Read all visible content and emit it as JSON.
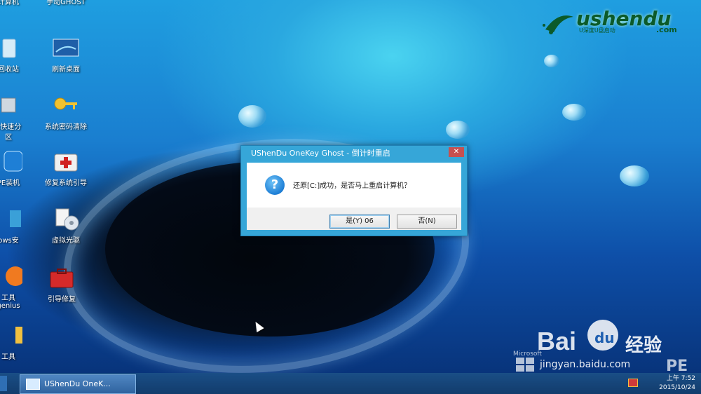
{
  "desktop": {
    "icons": [
      {
        "label": "计算机",
        "icon": "computer-icon"
      },
      {
        "label": "手动GHOST",
        "icon": "ghost-icon"
      },
      {
        "label": "回收站",
        "icon": "recycle-bin-icon"
      },
      {
        "label": "刷新桌面",
        "icon": "refresh-desktop-icon"
      },
      {
        "label": "K快速分\n区",
        "icon": "partition-icon"
      },
      {
        "label": "系统密码清除",
        "icon": "key-icon"
      },
      {
        "label": "PE装机",
        "icon": "pe-install-icon"
      },
      {
        "label": "修复系统引导",
        "icon": "medkit-icon"
      },
      {
        "label": "ows安",
        "icon": "windows-install-icon"
      },
      {
        "label": "虚拟光驱",
        "icon": "virtual-cd-icon"
      },
      {
        "label": "工具\ngenius",
        "icon": "disk-genius-icon"
      },
      {
        "label": "引导修复",
        "icon": "toolbox-icon"
      },
      {
        "label": "工具",
        "icon": "tool-icon"
      }
    ]
  },
  "logo": {
    "name": "ushendu",
    "sub": "U深度U盘启动",
    "dotcom": ".com"
  },
  "dialog": {
    "title": "UShenDu OneKey Ghost - 倒计时重启",
    "close": "✕",
    "question_icon": "?",
    "message": "还原[C:]成功，是否马上重启计算机？",
    "yes_label": "是(Y) 06",
    "no_label": "否(N)"
  },
  "taskbar": {
    "task_label": "UShenDu OneK...",
    "clock_time": "上午 7:52",
    "clock_date": "2015/10/24"
  },
  "watermark": {
    "bai": "Bai",
    "du": "du",
    "jingyan": "经验",
    "url": "jingyan.baidu.com"
  },
  "brand": {
    "microsoft": "Microsoft",
    "pe": "PE"
  }
}
